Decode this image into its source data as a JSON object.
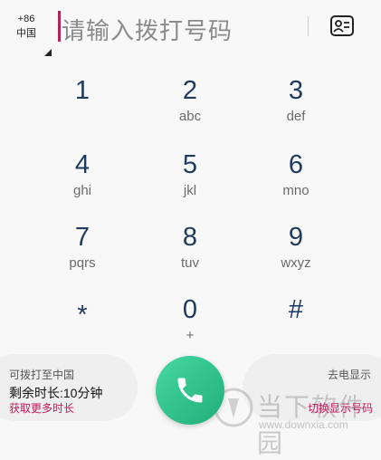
{
  "header": {
    "country_code": "+86",
    "country_name": "中国",
    "placeholder": "请输入拨打号码"
  },
  "keypad": [
    {
      "digit": "1",
      "letters": ""
    },
    {
      "digit": "2",
      "letters": "abc"
    },
    {
      "digit": "3",
      "letters": "def"
    },
    {
      "digit": "4",
      "letters": "ghi"
    },
    {
      "digit": "5",
      "letters": "jkl"
    },
    {
      "digit": "6",
      "letters": "mno"
    },
    {
      "digit": "7",
      "letters": "pqrs"
    },
    {
      "digit": "8",
      "letters": "tuv"
    },
    {
      "digit": "9",
      "letters": "wxyz"
    },
    {
      "digit": "*",
      "letters": ""
    },
    {
      "digit": "0",
      "letters": "+"
    },
    {
      "digit": "#",
      "letters": ""
    }
  ],
  "left_panel": {
    "line1": "可拨打至中国",
    "line2": "剩余时长:10分钟",
    "line3": "获取更多时长"
  },
  "right_panel": {
    "line1": "去电显示",
    "line2": "切换显示号码"
  },
  "watermark": {
    "name": "当下软件园",
    "url": "www.downxia.com"
  },
  "colors": {
    "call_button": "#2fc48b",
    "accent": "#c2185b",
    "digit": "#1d3a5f"
  },
  "icons": {
    "contacts": "contacts-card-icon",
    "call": "phone-icon",
    "dropdown": "dropdown-triangle-icon"
  }
}
